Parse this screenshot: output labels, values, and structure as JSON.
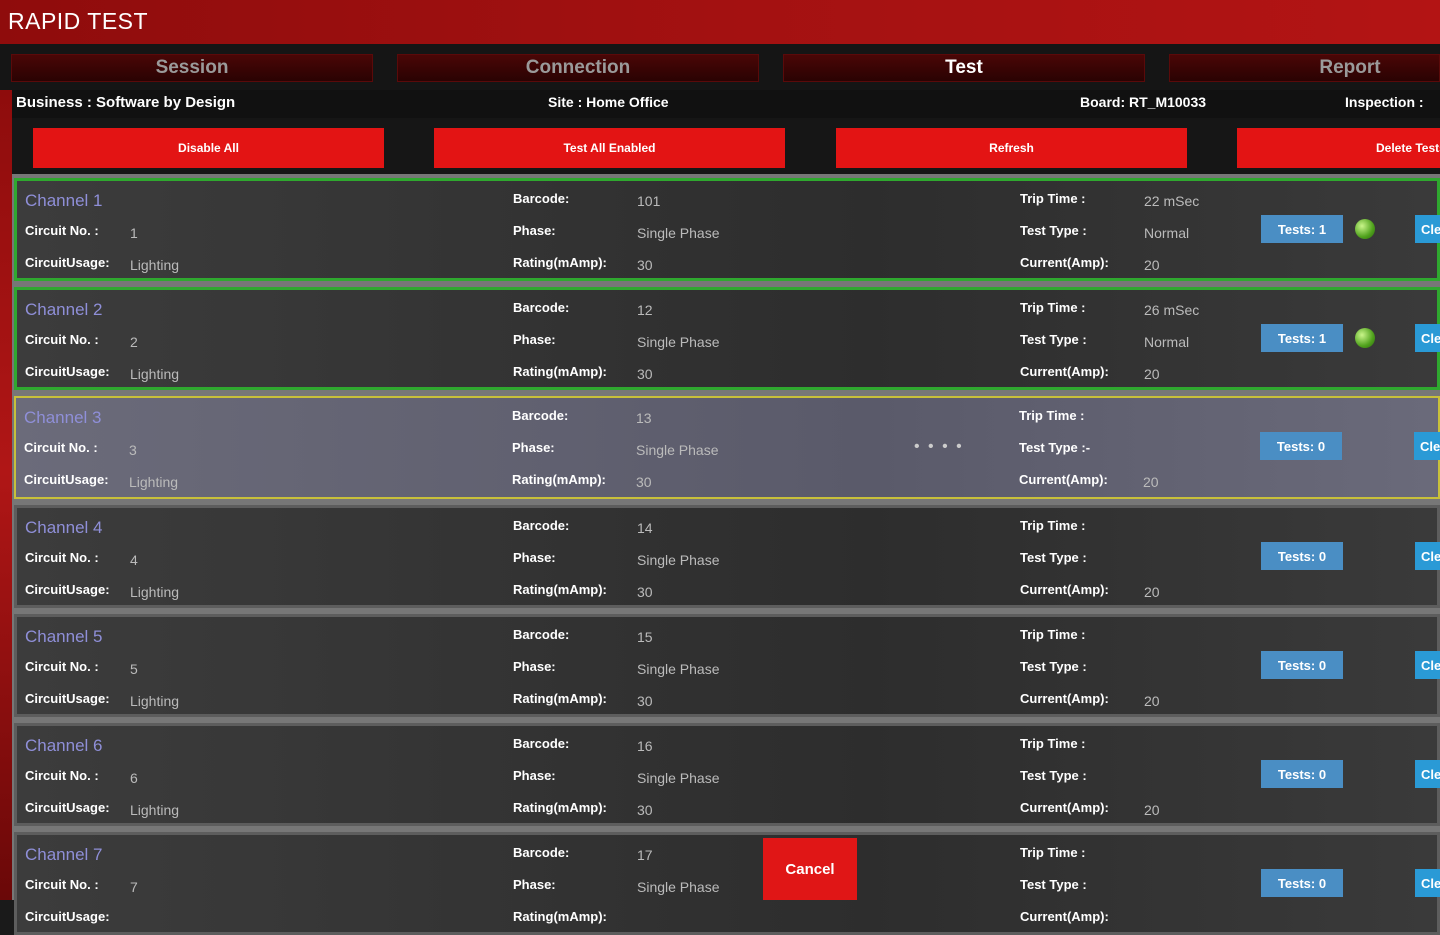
{
  "app": {
    "title": "RAPID TEST"
  },
  "tabs": [
    {
      "label": "Session"
    },
    {
      "label": "Connection"
    },
    {
      "label": "Test"
    },
    {
      "label": "Report"
    }
  ],
  "info": {
    "business": "Business : Software by Design",
    "site": "Site : Home Office",
    "board": "Board: RT_M10033",
    "inspection": "Inspection : "
  },
  "actions": {
    "disable_all": "Disable All",
    "test_all_enabled": "Test All Enabled",
    "refresh": "Refresh",
    "delete_tests": "Delete Tests"
  },
  "labels": {
    "circuit_no": "Circuit No. :",
    "circuit_usage": "CircuitUsage:",
    "barcode": "Barcode:",
    "phase": "Phase:",
    "rating": "Rating(mAmp):",
    "trip_time": "Trip Time :",
    "test_type": "Test Type :",
    "test_type_active": "Test Type :-",
    "current": "Current(Amp):"
  },
  "channels": [
    {
      "name": "Channel 1",
      "circuit_no": "1",
      "usage": "Lighting",
      "barcode": "101",
      "phase": "Single Phase",
      "rating": "30",
      "trip_time": "22 mSec",
      "test_type": "Normal",
      "current": "20",
      "tests": "Tests: 1",
      "side": "Clear",
      "status": "pass"
    },
    {
      "name": "Channel 2",
      "circuit_no": "2",
      "usage": "Lighting",
      "barcode": "12",
      "phase": "Single Phase",
      "rating": "30",
      "trip_time": "26 mSec",
      "test_type": "Normal",
      "current": "20",
      "tests": "Tests: 1",
      "side": "Clear",
      "status": "pass"
    },
    {
      "name": "Channel 3",
      "circuit_no": "3",
      "usage": "Lighting",
      "barcode": "13",
      "phase": "Single Phase",
      "rating": "30",
      "trip_time": "",
      "test_type": "",
      "current": "20",
      "tests": "Tests: 0",
      "side": "Clear",
      "status": "testing",
      "busy": "• • •      •"
    },
    {
      "name": "Channel 4",
      "circuit_no": "4",
      "usage": "Lighting",
      "barcode": "14",
      "phase": "Single Phase",
      "rating": "30",
      "trip_time": "",
      "test_type": "",
      "current": "20",
      "tests": "Tests: 0",
      "side": "Clear",
      "status": "none"
    },
    {
      "name": "Channel 5",
      "circuit_no": "5",
      "usage": "Lighting",
      "barcode": "15",
      "phase": "Single Phase",
      "rating": "30",
      "trip_time": "",
      "test_type": "",
      "current": "20",
      "tests": "Tests: 0",
      "side": "Clear",
      "status": "none"
    },
    {
      "name": "Channel 6",
      "circuit_no": "6",
      "usage": "Lighting",
      "barcode": "16",
      "phase": "Single Phase",
      "rating": "30",
      "trip_time": "",
      "test_type": "",
      "current": "20",
      "tests": "Tests: 0",
      "side": "Clear",
      "status": "none"
    },
    {
      "name": "Channel 7",
      "circuit_no": "7",
      "usage": "",
      "barcode": "17",
      "phase": "Single Phase",
      "rating": "",
      "trip_time": "",
      "test_type": "",
      "current": "",
      "tests": "Tests: 0",
      "side": "Clear",
      "status": "none"
    }
  ],
  "cancel": {
    "label": "Cancel"
  },
  "colors": {
    "accent": "#e31414",
    "title_bar": "#a31111",
    "pass": "#2fa82f",
    "selected": "#c8c03a",
    "tests_button": "#4a8ec4"
  }
}
